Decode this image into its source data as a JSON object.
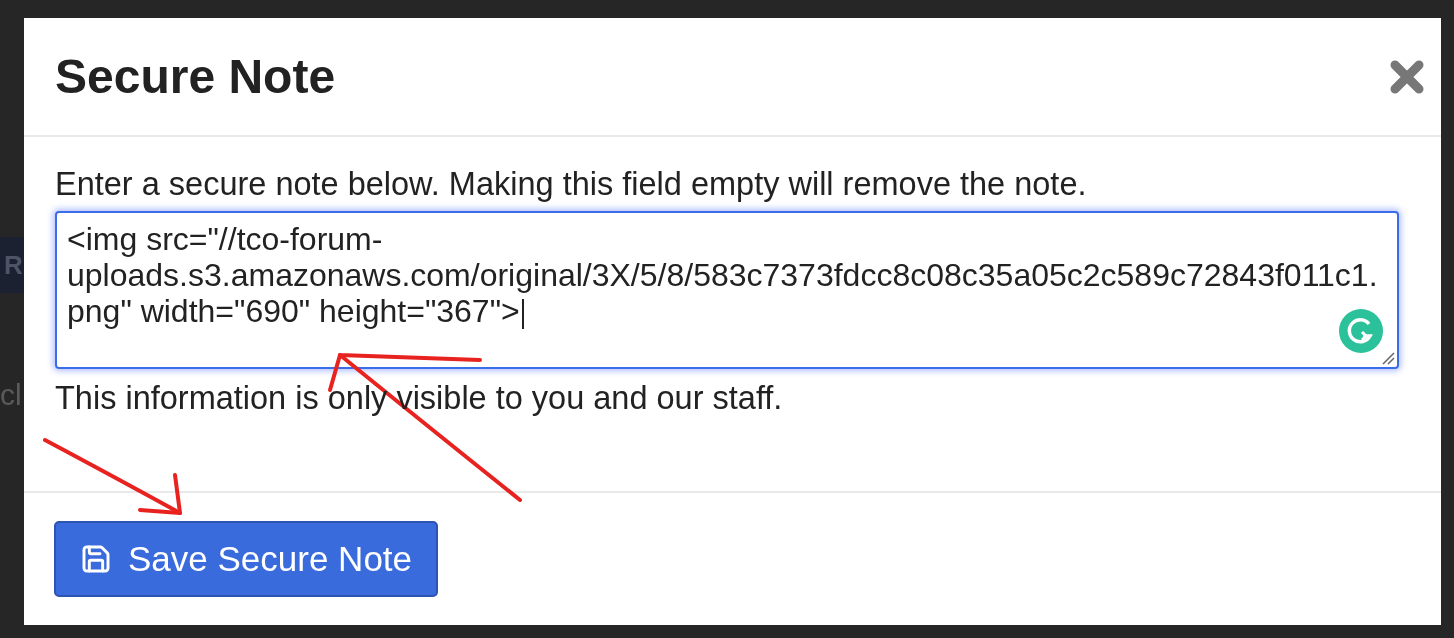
{
  "background": {
    "button_fragment": "R",
    "text_fragment": "cl"
  },
  "modal": {
    "title": "Secure Note",
    "instructions": "Enter a secure note below. Making this field empty will remove the note.",
    "note": {
      "value": "<img src=\"//tco-forum-uploads.s3.amazonaws.com/original/3X/5/8/583c7373fdcc8c08c35a05c2c589c72843f011c1.png\" width=\"690\" height=\"367\">",
      "focused": true
    },
    "privacy_text": "This information is only visible to you and our staff.",
    "save_button": "Save Secure Note"
  }
}
